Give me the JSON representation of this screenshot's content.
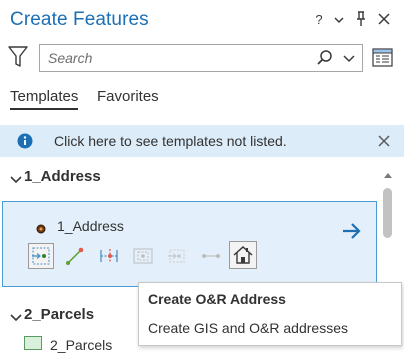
{
  "pane": {
    "title": "Create Features",
    "window_buttons": {
      "help": "?",
      "menu": "⌄",
      "pin": "⊺",
      "close": "✕"
    }
  },
  "search": {
    "placeholder": "Search",
    "value": ""
  },
  "tabs": [
    {
      "label": "Templates",
      "active": true
    },
    {
      "label": "Favorites",
      "active": false
    }
  ],
  "info_bar": {
    "text": "Click here to see templates not listed."
  },
  "groups": [
    {
      "name": "1_Address",
      "items": [
        {
          "name": "1_Address",
          "selected": true
        }
      ],
      "tools": [
        "point-tool",
        "point-at-end-of-line-tool",
        "point-along-line-tool",
        "point-in-polygon-tool",
        "point-offset-tool",
        "line-point-tool",
        "create-or-address-tool"
      ]
    },
    {
      "name": "2_Parcels",
      "items": [
        {
          "name": "2_Parcels",
          "selected": false
        }
      ]
    }
  ],
  "tooltip": {
    "title": "Create O&R Address",
    "description": "Create GIS and O&R addresses"
  },
  "colors": {
    "title": "#1b6fb5",
    "info_bar_bg": "#dcecf8",
    "selection_bg": "#e3f0fb",
    "selection_border": "#4a9bd6",
    "arrow": "#1b6fb5",
    "parcel_swatch": "#d8f0dc"
  }
}
